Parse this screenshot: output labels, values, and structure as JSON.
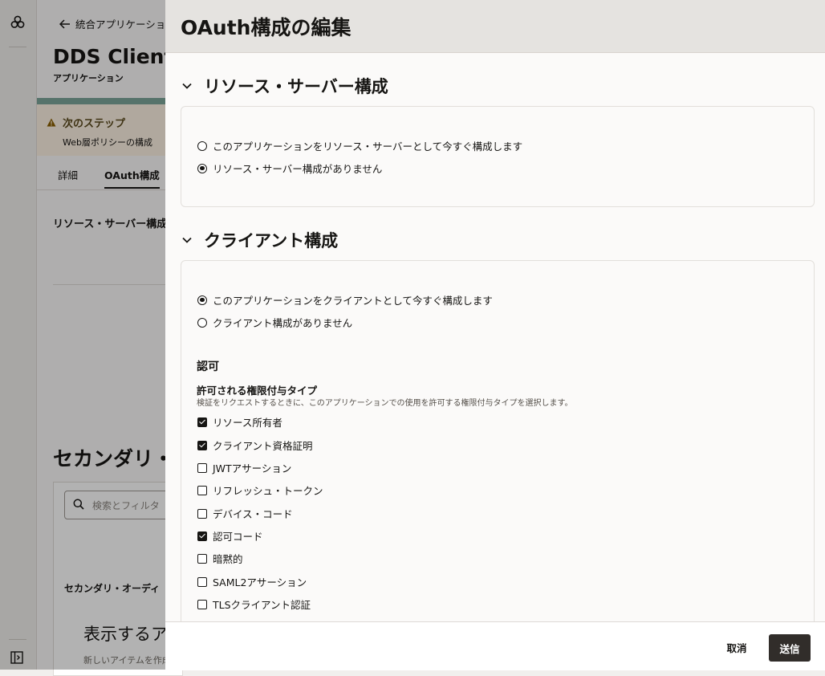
{
  "background": {
    "back_link": "統合アプリケーション",
    "app_title": "DDS Client",
    "app_subtitle": "アプリケーション",
    "next_steps_title": "次のステップ",
    "next_steps_text": "Web層ポリシーの構成",
    "tabs": [
      {
        "label": "詳細",
        "active": false
      },
      {
        "label": "OAuth構成",
        "active": true
      }
    ],
    "resource_server_heading": "リソース・サーバー構成",
    "secondary_heading": "セカンダリ・",
    "search_placeholder": "検索とフィルタ",
    "column_header": "セカンダリ・オーディ",
    "empty_title": "表示するア",
    "empty_subtitle": "新しいアイテムを作成"
  },
  "drawer": {
    "title": "OAuth構成の編集",
    "resource_server": {
      "heading": "リソース・サーバー構成",
      "options": [
        {
          "label": "このアプリケーションをリソース・サーバーとして今すぐ構成します",
          "selected": false
        },
        {
          "label": "リソース・サーバー構成がありません",
          "selected": true
        }
      ]
    },
    "client": {
      "heading": "クライアント構成",
      "options": [
        {
          "label": "このアプリケーションをクライアントとして今すぐ構成します",
          "selected": true
        },
        {
          "label": "クライアント構成がありません",
          "selected": false
        }
      ],
      "authorization_heading": "認可",
      "grant_types_label": "許可される権限付与タイプ",
      "grant_types_help": "検証をリクエストするときに、このアプリケーションでの使用を許可する権限付与タイプを選択します。",
      "grant_types": [
        {
          "label": "リソース所有者",
          "checked": true
        },
        {
          "label": "クライアント資格証明",
          "checked": true
        },
        {
          "label": "JWTアサーション",
          "checked": false
        },
        {
          "label": "リフレッシュ・トークン",
          "checked": false
        },
        {
          "label": "デバイス・コード",
          "checked": false
        },
        {
          "label": "認可コード",
          "checked": true
        },
        {
          "label": "暗黙的",
          "checked": false
        },
        {
          "label": "SAML2アサーション",
          "checked": false
        },
        {
          "label": "TLSクライアント認証",
          "checked": false
        }
      ]
    },
    "footer": {
      "cancel_label": "取消",
      "submit_label": "送信"
    }
  }
}
